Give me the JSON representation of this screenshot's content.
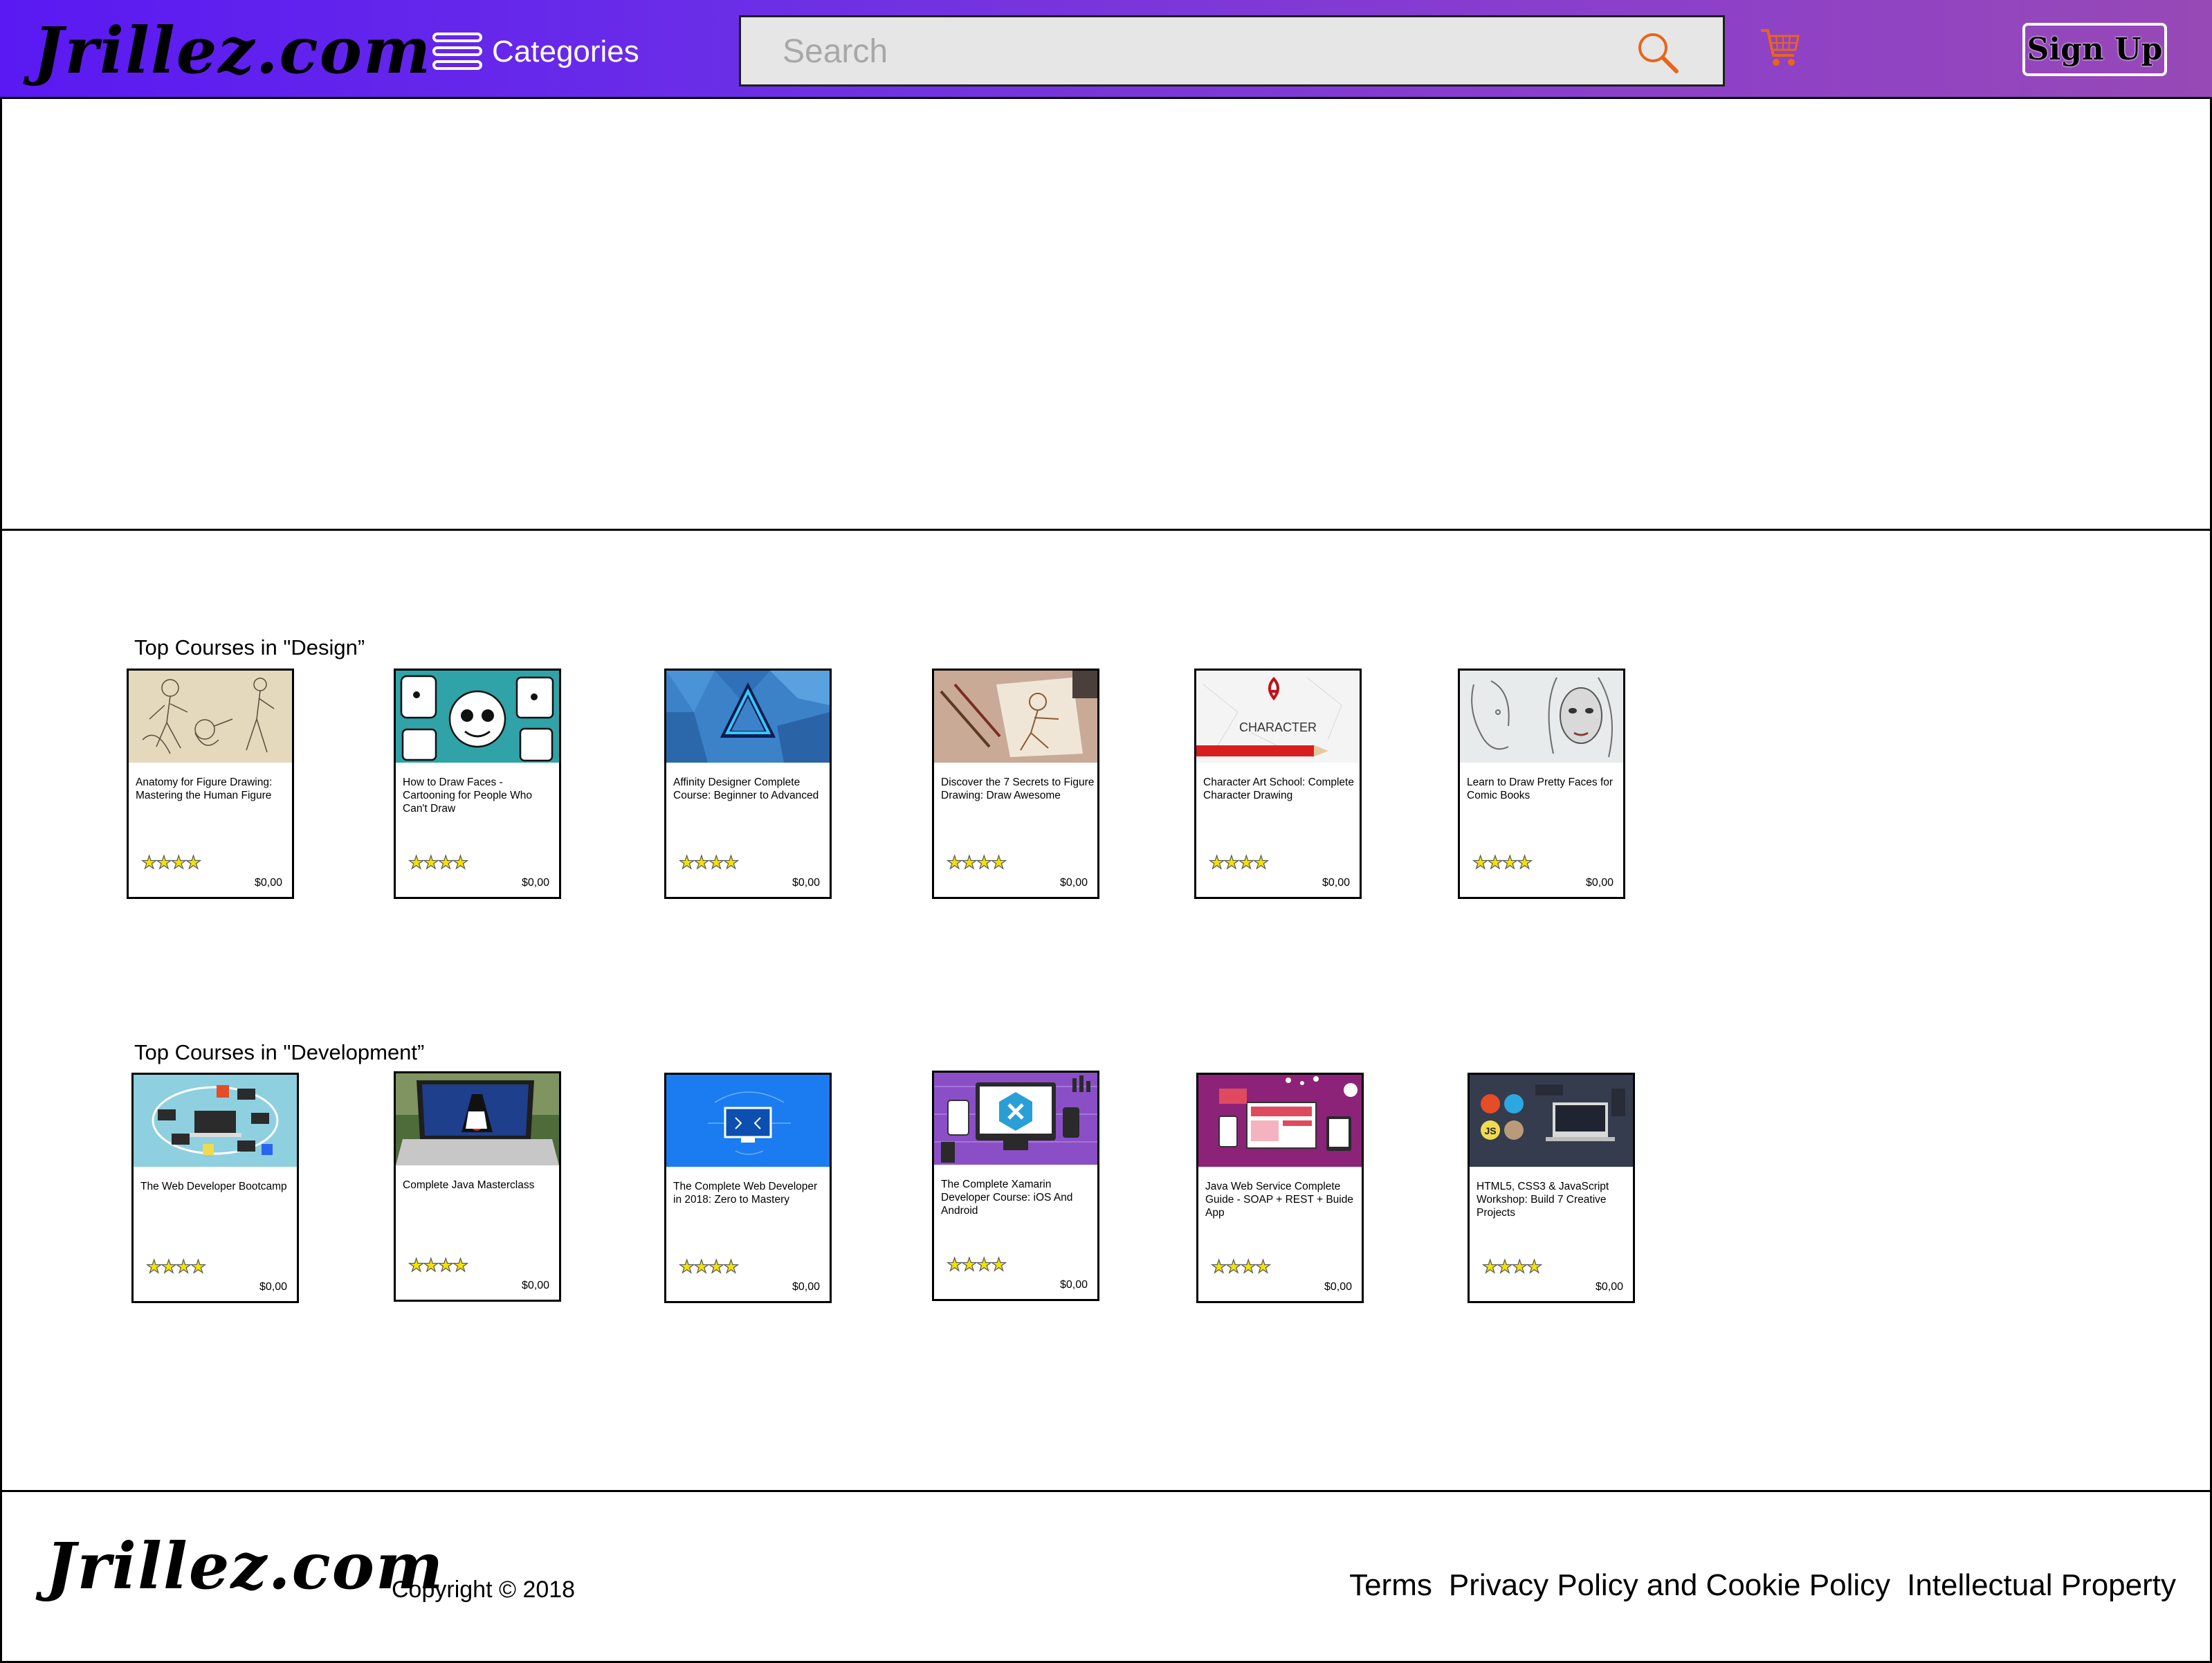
{
  "header": {
    "logo": "Jrillez.com",
    "categories_label": "Categories",
    "search_placeholder": "Search",
    "signup_label": "Sign Up"
  },
  "design": {
    "title": "Top Courses in \"Design”",
    "courses": [
      {
        "title": "Anatomy for Figure Drawing: Mastering the Human Figure",
        "stars": "★★★★",
        "price": "$0,00"
      },
      {
        "title": "How to Draw Faces - Cartooning for People Who Can't Draw",
        "stars": "★★★★",
        "price": "$0,00"
      },
      {
        "title": "Affinity Designer Complete Course: Beginner to Advanced",
        "stars": "★★★★",
        "price": "$0,00"
      },
      {
        "title": "Discover the 7 Secrets to Figure Drawing: Draw Awesome",
        "stars": "★★★★",
        "price": "$0,00"
      },
      {
        "title": "Character Art School: Complete Character Drawing",
        "stars": "★★★★",
        "price": "$0,00",
        "thumb_text": "CHARACTER"
      },
      {
        "title": "Learn to Draw Pretty Faces for Comic Books",
        "stars": "★★★★",
        "price": "$0,00"
      }
    ]
  },
  "development": {
    "title": "Top Courses in \"Development”",
    "courses": [
      {
        "title": "The Web Developer Bootcamp",
        "stars": "★★★★",
        "price": "$0,00"
      },
      {
        "title": "Complete Java Masterclass",
        "stars": "★★★★",
        "price": "$0,00"
      },
      {
        "title": "The Complete Web Developer in 2018: Zero to Mastery",
        "stars": "★★★★",
        "price": "$0,00"
      },
      {
        "title": "The Complete Xamarin Developer Course: iOS And Android",
        "stars": "★★★★",
        "price": "$0,00"
      },
      {
        "title": "Java Web Service Complete Guide - SOAP + REST + Buide App",
        "stars": "★★★★",
        "price": "$0,00"
      },
      {
        "title": "HTML5, CSS3 & JavaScript Workshop: Build 7 Creative Projects",
        "stars": "★★★★",
        "price": "$0,00"
      }
    ]
  },
  "footer": {
    "logo": "Jrillez.com",
    "copyright": "Copyright © 2018",
    "links": [
      "Terms",
      "Privacy Policy and Cookie Policy",
      "Intellectual Property"
    ]
  },
  "colors": {
    "header_start": "#5a19f2",
    "header_end": "#9749b6",
    "accent_orange": "#e8651a",
    "star_yellow": "#f5e100"
  },
  "icons": {
    "categories": "list-menu-icon",
    "search": "magnifier-icon",
    "cart": "shopping-cart-icon",
    "rating": "star-icon"
  }
}
